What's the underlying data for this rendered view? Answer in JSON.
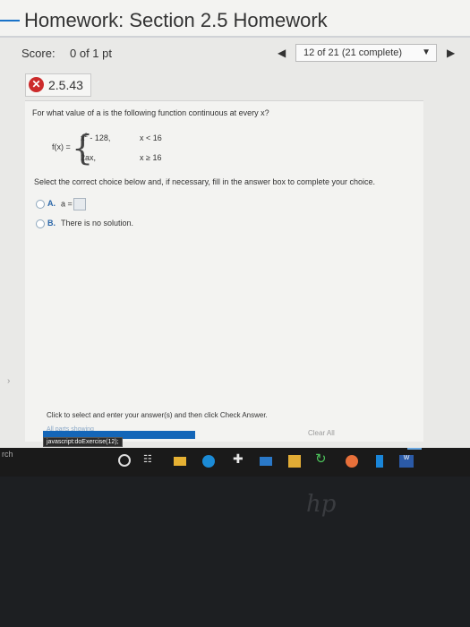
{
  "header": {
    "title": "Homework: Section 2.5 Homework"
  },
  "score": {
    "label": "Score:",
    "value": "0 of 1 pt"
  },
  "navigation": {
    "prev_icon": "◀",
    "progress": "12 of 21 (21 complete)",
    "caret_icon": "▼",
    "next_icon": "▶"
  },
  "question": {
    "status_icon": "✕",
    "number": "2.5.43",
    "text": "For what value of a is the following function continuous at every x?",
    "function": {
      "label": "f(x) =",
      "piece1_expr": "x",
      "piece1_exp": "2",
      "piece1_rest": " - 128,",
      "piece1_cond": "x < 16",
      "piece2_expr": "2ax,",
      "piece2_cond": "x ≥ 16"
    },
    "instruction": "Select the correct choice below and, if necessary, fill in the answer box to complete your choice.",
    "choices": [
      {
        "letter": "A.",
        "text": "a ="
      },
      {
        "letter": "B.",
        "text": "There is no solution."
      }
    ]
  },
  "footer": {
    "help": "Click to select and enter your answer(s) and then click Check Answer.",
    "overlap": "All parts showing",
    "status_tooltip": "javascript:doExercise(12);",
    "clear_label": "Clear All"
  },
  "taskbar": {
    "search_fragment": "rch",
    "taskview_icon": "☷",
    "tool_icon": "✚",
    "refresh_icon": "↻",
    "word_icon": "W"
  },
  "left_arrow": "›",
  "hp": "hp"
}
